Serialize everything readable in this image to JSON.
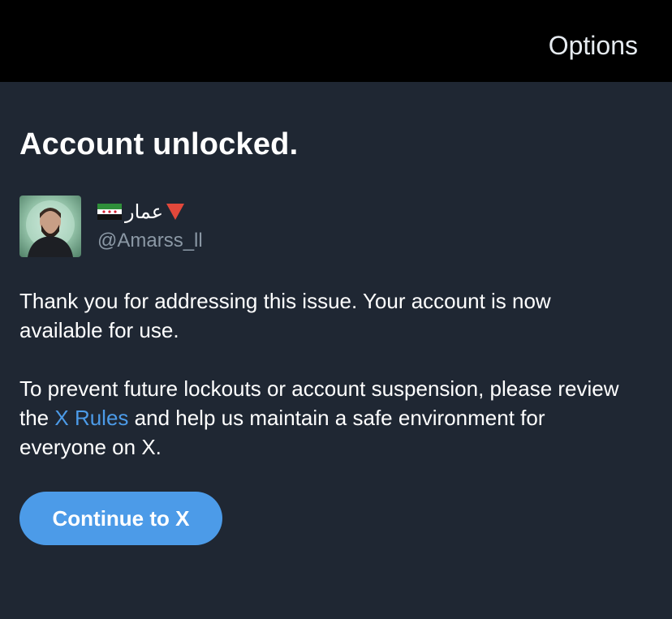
{
  "header": {
    "options_label": "Options"
  },
  "main": {
    "title": "Account unlocked.",
    "user": {
      "display_name": "عمار",
      "handle": "@Amarss_ll",
      "flag_icon": "syrian-independence-flag-icon",
      "badge_icon": "red-down-triangle-icon"
    },
    "paragraph1": "Thank you for addressing this issue. Your account is now available for use.",
    "paragraph2_before": "To prevent future lockouts or account suspension, please review the ",
    "paragraph2_link": "X Rules",
    "paragraph2_after": " and help us maintain a safe environment for everyone on X.",
    "continue_label": "Continue to X"
  },
  "colors": {
    "background": "#1f2733",
    "topbar": "#000000",
    "accent": "#4c9be8",
    "secondary_text": "#8b98a5"
  }
}
